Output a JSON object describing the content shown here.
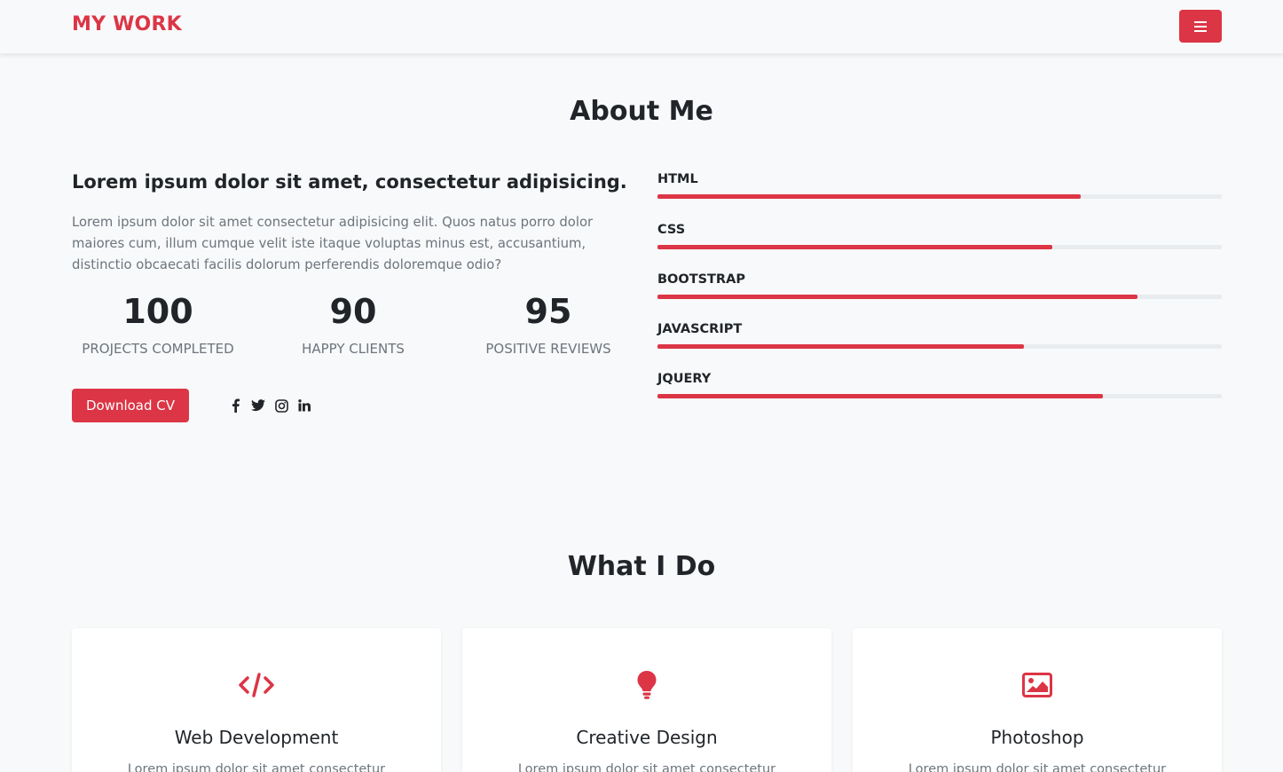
{
  "navbar": {
    "brand": "MY WORK",
    "menu_icon": "hamburger-icon"
  },
  "about": {
    "title": "About Me",
    "heading": "Lorem ipsum dolor sit amet, consectetur adipisicing.",
    "text": "Lorem ipsum dolor sit amet consectetur adipisicing elit. Quos natus porro dolor maiores cum, illum cumque velit iste itaque voluptas minus est, accusantium, distinctio obcaecati facilis dolorum perferendis doloremque odio?",
    "stats": [
      {
        "number": "100",
        "label": "PROJECTS COMPLETED"
      },
      {
        "number": "90",
        "label": "HAPPY CLIENTS"
      },
      {
        "number": "95",
        "label": "POSITIVE REVIEWS"
      }
    ],
    "cv_button": "Download CV",
    "socials": [
      "facebook-icon",
      "twitter-icon",
      "instagram-icon",
      "linkedin-icon"
    ],
    "skills": [
      {
        "name": "HTML",
        "level": 0.75
      },
      {
        "name": "CSS",
        "level": 0.7
      },
      {
        "name": "BOOTSTRAP",
        "level": 0.85
      },
      {
        "name": "JAVASCRIPT",
        "level": 0.65
      },
      {
        "name": "JQUERY",
        "level": 0.79
      }
    ]
  },
  "services": {
    "title": "What I Do",
    "cards": [
      {
        "icon": "code-icon",
        "title": "Web Development",
        "text": "Lorem ipsum dolor sit amet consectetur"
      },
      {
        "icon": "lightbulb-icon",
        "title": "Creative Design",
        "text": "Lorem ipsum dolor sit amet consectetur"
      },
      {
        "icon": "image-icon",
        "title": "Photoshop",
        "text": "Lorem ipsum dolor sit amet consectetur"
      }
    ]
  },
  "colors": {
    "accent": "#dc3545",
    "background": "#f8f9fa",
    "text": "#212529",
    "muted": "#6c757d",
    "track": "#e9ecef"
  }
}
